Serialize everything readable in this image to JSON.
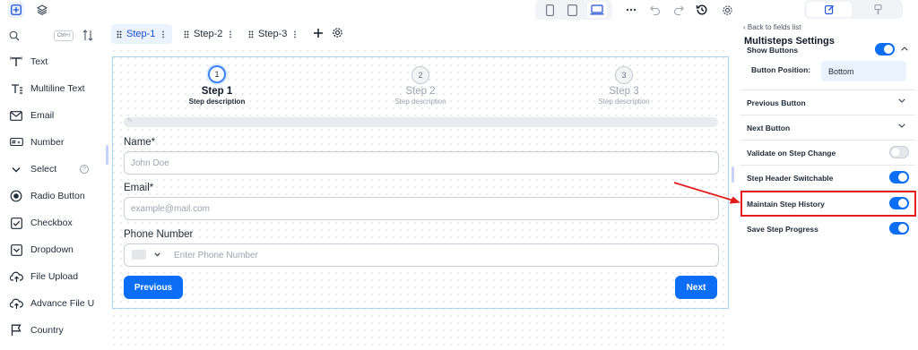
{
  "toolbar": {
    "left_icons": [
      "add-square-icon",
      "layers-icon"
    ],
    "device_icons": [
      "mobile-icon",
      "tablet-icon",
      "desktop-icon"
    ],
    "active_device": "desktop",
    "action_icons": [
      "more-icon",
      "undo-icon",
      "redo-icon",
      "history-icon",
      "settings-icon"
    ],
    "right_tabs": [
      "edit-icon",
      "brush-icon"
    ],
    "active_right_tab": "edit"
  },
  "left_panel": {
    "search_shortcut": "Ctrl+/",
    "fields": [
      {
        "label": "Text",
        "icon": "text-icon"
      },
      {
        "label": "Multiline Text",
        "icon": "multiline-text-icon"
      },
      {
        "label": "Email",
        "icon": "email-icon"
      },
      {
        "label": "Number",
        "icon": "number-icon"
      },
      {
        "label": "Select",
        "icon": "chevron-down-icon",
        "help": "?"
      },
      {
        "label": "Radio Button",
        "icon": "radio-icon"
      },
      {
        "label": "Checkbox",
        "icon": "checkbox-icon"
      },
      {
        "label": "Dropdown",
        "icon": "dropdown-icon"
      },
      {
        "label": "File Upload",
        "icon": "upload-icon"
      },
      {
        "label": "Advance File U",
        "icon": "upload-icon"
      },
      {
        "label": "Country",
        "icon": "flag-icon"
      }
    ]
  },
  "step_tabs": [
    {
      "label": "Step-1",
      "active": true
    },
    {
      "label": "Step-2",
      "active": false
    },
    {
      "label": "Step-3",
      "active": false
    }
  ],
  "form": {
    "steps": [
      {
        "number": "1",
        "title": "Step 1",
        "description": "Step description",
        "active": true
      },
      {
        "number": "2",
        "title": "Step 2",
        "description": "Step description",
        "active": false
      },
      {
        "number": "3",
        "title": "Step 3",
        "description": "Step description",
        "active": false
      }
    ],
    "progress": 0,
    "progress_label": "%",
    "fields": {
      "name": {
        "label": "Name*",
        "placeholder": "John Doe"
      },
      "email": {
        "label": "Email*",
        "placeholder": "example@mail.com"
      },
      "phone": {
        "label": "Phone Number",
        "placeholder": "Enter Phone Number"
      }
    },
    "previous_label": "Previous",
    "next_label": "Next"
  },
  "settings": {
    "back_label": "Back to fields list",
    "title": "Multisteps Settings",
    "show_buttons_label": "Show Buttons",
    "button_position_label": "Button Position:",
    "button_position_value": "Bottom",
    "previous_button_label": "Previous Button",
    "next_button_label": "Next Button",
    "validate_label": "Validate on Step Change",
    "validate_on": false,
    "header_switchable_label": "Step Header Switchable",
    "header_switchable_on": true,
    "maintain_history_label": "Maintain Step History",
    "maintain_history_on": true,
    "save_progress_label": "Save Step Progress",
    "save_progress_on": true,
    "highlight_color": "#e11d1d",
    "accent_color": "#0b6ef5"
  }
}
